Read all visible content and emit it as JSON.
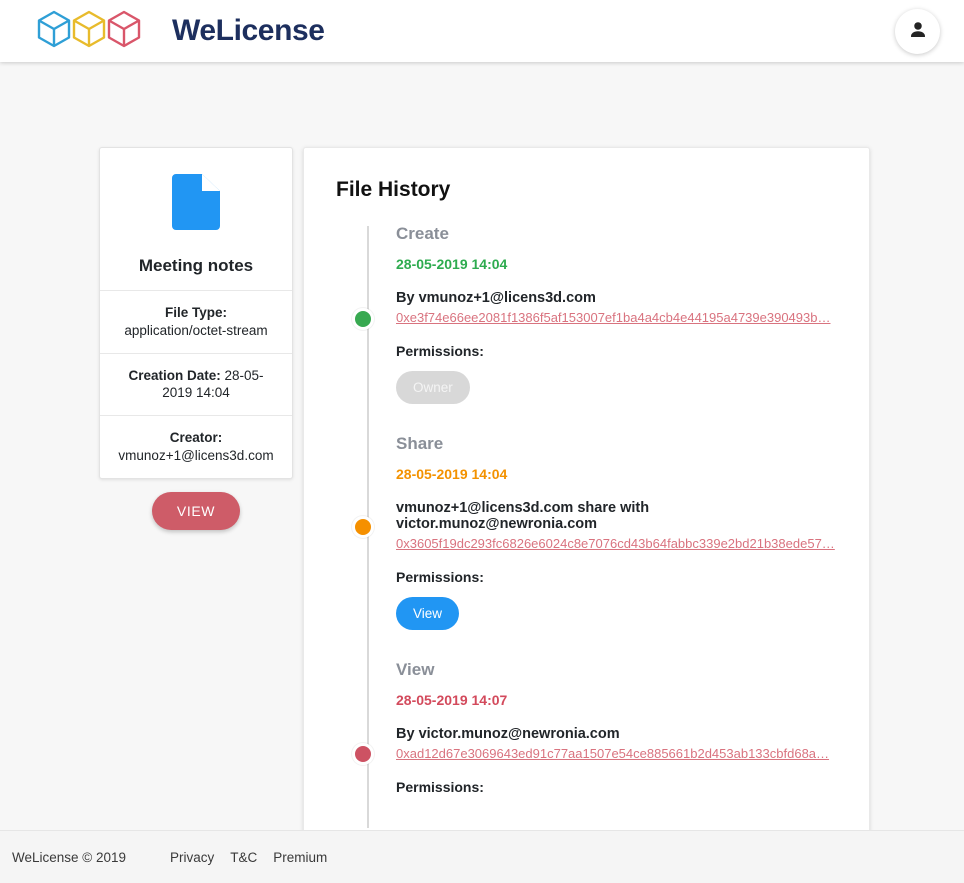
{
  "header": {
    "brand_name": "WeLicense",
    "logo_icon": "three-cubes-icon",
    "logo_colors": [
      "#2f9fd6",
      "#e8bb2c",
      "#d9566a"
    ],
    "avatar_icon": "person-icon"
  },
  "file_card": {
    "icon": "document-icon",
    "icon_color": "#2196f3",
    "title": "Meeting notes",
    "rows": [
      {
        "label": "File Type:",
        "value": "application/octet-stream"
      },
      {
        "label": "Creation Date:",
        "value": "28-05-2019 14:04"
      },
      {
        "label": "Creator:",
        "value": "vmunoz+1@licens3d.com"
      }
    ],
    "view_button_label": "VIEW",
    "view_button_color": "#ce5c68"
  },
  "history": {
    "title": "File History",
    "permissions_label": "Permissions:",
    "entries": [
      {
        "action": "Create",
        "date": "28-05-2019 14:04",
        "date_color": "#2eab4f",
        "dot_color": "#38a951",
        "actor": "By vmunoz+1@licens3d.com",
        "hash": "0xe3f74e66ee2081f1386f5af153007ef1ba4a4cb4e44195a4739e390493b…",
        "permissions_label": "Permissions:",
        "badge": {
          "label": "Owner",
          "style": "owner",
          "color": "#d8d8d8"
        }
      },
      {
        "action": "Share",
        "date": "28-05-2019 14:04",
        "date_color": "#f39200",
        "dot_color": "#f59000",
        "actor": "vmunoz+1@licens3d.com share with victor.munoz@newronia.com",
        "hash": "0x3605f19dc293fc6826e6024c8e7076cd43b64fabbc339e2bd21b38ede57…",
        "permissions_label": "Permissions:",
        "badge": {
          "label": "View",
          "style": "view",
          "color": "#2196f3"
        }
      },
      {
        "action": "View",
        "date": "28-05-2019 14:07",
        "date_color": "#d34a5c",
        "dot_color": "#cd5263",
        "actor": "By victor.munoz@newronia.com",
        "hash": "0xad12d67e3069643ed91c77aa1507e54ce885661b2d453ab133cbfd68a…",
        "permissions_label": "Permissions:",
        "badge": null
      }
    ]
  },
  "footer": {
    "copyright": "WeLicense © 2019",
    "links": [
      {
        "label": "Privacy"
      },
      {
        "label": "T&C"
      },
      {
        "label": "Premium"
      }
    ]
  }
}
